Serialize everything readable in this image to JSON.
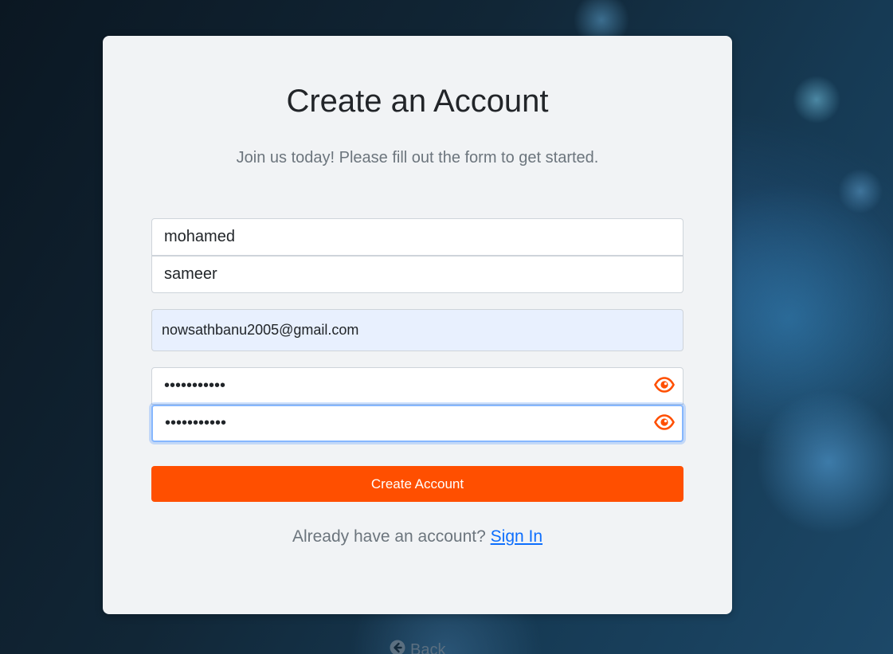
{
  "form": {
    "title": "Create an Account",
    "subtitle": "Join us today! Please fill out the form to get started.",
    "first_name_value": "mohamed",
    "last_name_value": "sameer",
    "email_value": "nowsathbanu2005@gmail.com",
    "password_value": "•••••••••••",
    "confirm_password_value": "•••••••••••",
    "password_toggle_icon": "eye-icon",
    "submit_label": "Create Account",
    "signin_prompt": "Already have an account?",
    "signin_link_label": "Sign In"
  },
  "footer": {
    "back_icon": "arrow-left-circle-icon",
    "back_label": "Back"
  },
  "colors": {
    "accent": "#ff4f00",
    "link": "#0d6efd",
    "card_bg": "#f1f3f5",
    "autofill_bg": "#e8f0fe"
  }
}
